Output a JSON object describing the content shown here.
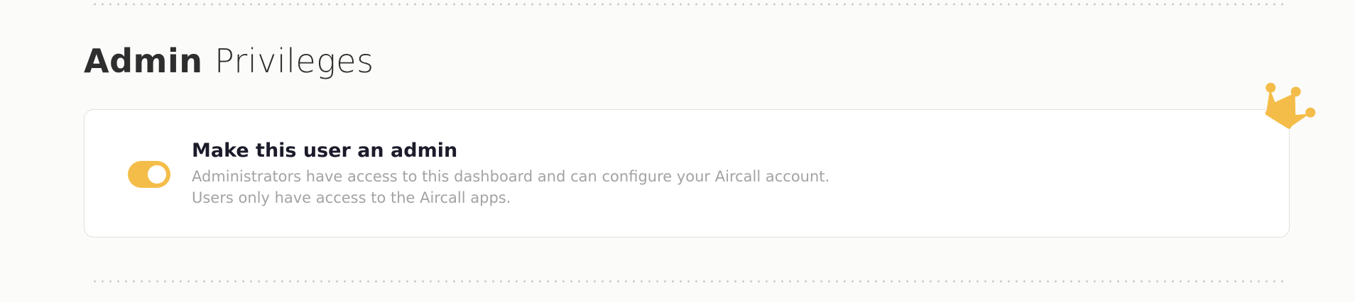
{
  "section": {
    "title_bold": "Admin",
    "title_light": "Privileges"
  },
  "admin_option": {
    "title": "Make this user an admin",
    "description_line1": "Administrators have access to this dashboard and can configure your Aircall account.",
    "description_line2": "Users only have access to the Aircall apps.",
    "toggle_on": true
  },
  "icons": {
    "badge": "crown-icon"
  },
  "colors": {
    "accent": "#f4bd49",
    "background": "#fbfbf9",
    "card_border": "#e1e1dd",
    "muted_text": "#a3a3a3",
    "title_text": "#1b1b2a"
  }
}
